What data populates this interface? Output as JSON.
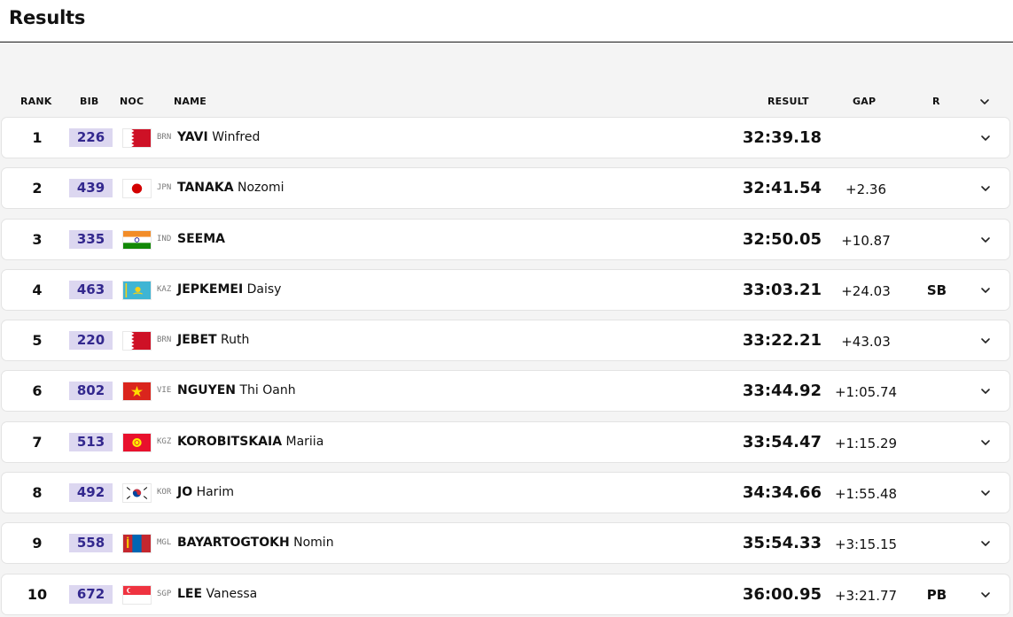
{
  "page": {
    "title": "Results"
  },
  "table": {
    "headers": {
      "rank": "RANK",
      "bib": "BIB",
      "noc": "NOC",
      "name": "NAME",
      "result": "RESULT",
      "gap": "GAP",
      "record": "R"
    },
    "rows": [
      {
        "rank": "1",
        "bib": "226",
        "noc": "BRN",
        "flag": "bahrain-flag",
        "last": "YAVI",
        "first": "Winfred",
        "result": "32:39.18",
        "gap": "",
        "record": ""
      },
      {
        "rank": "2",
        "bib": "439",
        "noc": "JPN",
        "flag": "japan-flag",
        "last": "TANAKA",
        "first": "Nozomi",
        "result": "32:41.54",
        "gap": "+2.36",
        "record": ""
      },
      {
        "rank": "3",
        "bib": "335",
        "noc": "IND",
        "flag": "india-flag",
        "last": "SEEMA",
        "first": "",
        "result": "32:50.05",
        "gap": "+10.87",
        "record": ""
      },
      {
        "rank": "4",
        "bib": "463",
        "noc": "KAZ",
        "flag": "kazakhstan-flag",
        "last": "JEPKEMEI",
        "first": "Daisy",
        "result": "33:03.21",
        "gap": "+24.03",
        "record": "SB"
      },
      {
        "rank": "5",
        "bib": "220",
        "noc": "BRN",
        "flag": "bahrain-flag",
        "last": "JEBET",
        "first": "Ruth",
        "result": "33:22.21",
        "gap": "+43.03",
        "record": ""
      },
      {
        "rank": "6",
        "bib": "802",
        "noc": "VIE",
        "flag": "vietnam-flag",
        "last": "NGUYEN",
        "first": "Thi Oanh",
        "result": "33:44.92",
        "gap": "+1:05.74",
        "record": ""
      },
      {
        "rank": "7",
        "bib": "513",
        "noc": "KGZ",
        "flag": "kyrgyzstan-flag",
        "last": "KOROBITSKAIA",
        "first": "Mariia",
        "result": "33:54.47",
        "gap": "+1:15.29",
        "record": ""
      },
      {
        "rank": "8",
        "bib": "492",
        "noc": "KOR",
        "flag": "korea-flag",
        "last": "JO",
        "first": "Harim",
        "result": "34:34.66",
        "gap": "+1:55.48",
        "record": ""
      },
      {
        "rank": "9",
        "bib": "558",
        "noc": "MGL",
        "flag": "mongolia-flag",
        "last": "BAYARTOGTOKH",
        "first": "Nomin",
        "result": "35:54.33",
        "gap": "+3:15.15",
        "record": ""
      },
      {
        "rank": "10",
        "bib": "672",
        "noc": "SGP",
        "flag": "singapore-flag",
        "last": "LEE",
        "first": "Vanessa",
        "result": "36:00.95",
        "gap": "+3:21.77",
        "record": "PB"
      }
    ]
  },
  "colors": {
    "bib_bg": "#dcd7f0",
    "bib_text": "#33288e",
    "row_bg": "#ffffff",
    "page_bg": "#f4f4f4"
  }
}
